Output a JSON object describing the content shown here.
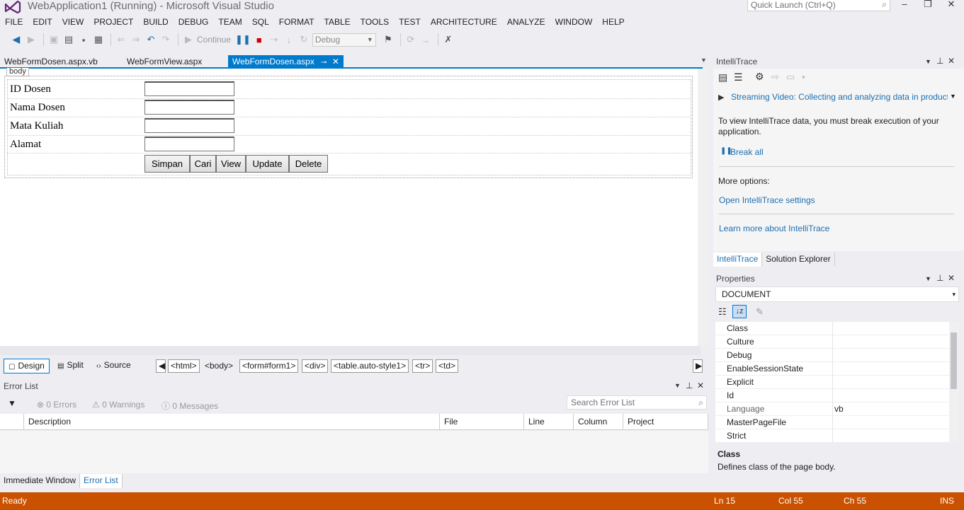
{
  "window": {
    "title": "WebApplication1 (Running) - Microsoft Visual Studio",
    "quick_launch_placeholder": "Quick Launch (Ctrl+Q)",
    "minimize": "‒",
    "maximize": "❐",
    "close": "✕"
  },
  "menu": [
    "FILE",
    "EDIT",
    "VIEW",
    "PROJECT",
    "BUILD",
    "DEBUG",
    "TEAM",
    "SQL",
    "FORMAT",
    "TABLE",
    "TOOLS",
    "TEST",
    "ARCHITECTURE",
    "ANALYZE",
    "WINDOW",
    "HELP"
  ],
  "toolbar": {
    "continue_label": "Continue",
    "config_value": "Debug"
  },
  "doc_tabs": [
    {
      "label": "WebFormDosen.aspx.vb"
    },
    {
      "label": "WebFormView.aspx"
    },
    {
      "label": "WebFormDosen.aspx",
      "active": true
    }
  ],
  "designer": {
    "body_tag": "body",
    "fields": [
      {
        "label": "ID Dosen",
        "value": ""
      },
      {
        "label": "Nama Dosen",
        "value": ""
      },
      {
        "label": "Mata Kuliah",
        "value": ""
      },
      {
        "label": "Alamat",
        "value": ""
      }
    ],
    "buttons": [
      "Simpan",
      "Cari",
      "View",
      "Update",
      "Delete"
    ]
  },
  "view_bar": {
    "design": "Design",
    "split": "Split",
    "source": "Source",
    "breadcrumbs": [
      "<html>",
      "<body>",
      "<form#form1>",
      "<div>",
      "<table.auto-style1>",
      "<tr>",
      "<td>"
    ]
  },
  "error_list": {
    "title": "Error List",
    "errors": "0 Errors",
    "warnings": "0 Warnings",
    "messages": "0 Messages",
    "search_placeholder": "Search Error List",
    "columns": [
      "Description",
      "File",
      "Line",
      "Column",
      "Project"
    ]
  },
  "bottom_tabs": [
    "Immediate Window",
    "Error List"
  ],
  "intellitrace": {
    "title": "IntelliTrace",
    "video_link": "Streaming Video: Collecting and analyzing data in product",
    "info": "To view IntelliTrace data, you must break execution of your application.",
    "break_all": "Break all",
    "more_options": "More options:",
    "settings_link": "Open IntelliTrace settings",
    "learn_link": "Learn more about IntelliTrace"
  },
  "pane_tabs": [
    "IntelliTrace",
    "Solution Explorer"
  ],
  "properties": {
    "title": "Properties",
    "object": "DOCUMENT",
    "rows": [
      {
        "name": "Class",
        "value": ""
      },
      {
        "name": "Culture",
        "value": ""
      },
      {
        "name": "Debug",
        "value": ""
      },
      {
        "name": "EnableSessionState",
        "value": ""
      },
      {
        "name": "Explicit",
        "value": ""
      },
      {
        "name": "Id",
        "value": ""
      },
      {
        "name": "Language",
        "value": "vb"
      },
      {
        "name": "MasterPageFile",
        "value": ""
      },
      {
        "name": "Strict",
        "value": ""
      }
    ],
    "desc_title": "Class",
    "desc_text": "Defines class of the page body."
  },
  "status": {
    "state": "Ready",
    "line": "Ln 15",
    "col": "Col 55",
    "ch": "Ch 55",
    "mode": "INS"
  },
  "colors": {
    "accent": "#007acc",
    "status_bar": "#ca5100"
  }
}
